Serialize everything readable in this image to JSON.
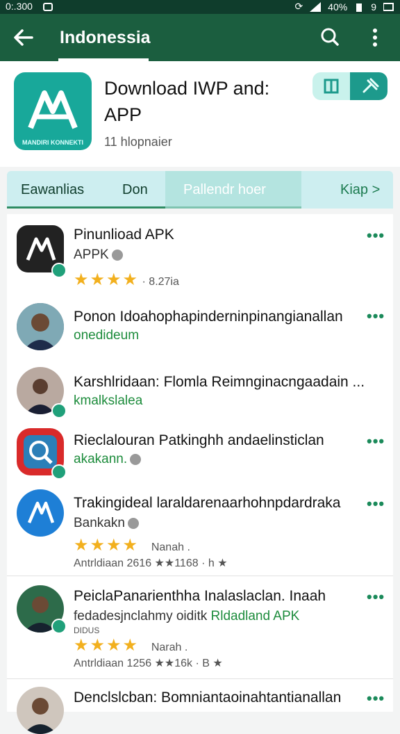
{
  "status": {
    "time": "0:.300",
    "battery": "40%",
    "signal_label": "9"
  },
  "appbar": {
    "title": "Indonessia",
    "back_icon": "arrow-left-icon",
    "search_icon": "search-icon",
    "more_icon": "more-vert-icon"
  },
  "header": {
    "app_title": "Download IWP and: APP",
    "subtitle": "11 hlopnaier",
    "icon_caption": "MANDIRI KONNEKTI"
  },
  "tabs": [
    {
      "label": "Eawanlias"
    },
    {
      "label": "Don"
    },
    {
      "label": "Pallendr hoer"
    },
    {
      "label": "Kiap >"
    }
  ],
  "list": [
    {
      "title": "Pinunlioad APK",
      "line2": "APPK",
      "rating_text": "· 8.27ia"
    },
    {
      "title": "Ponon Idoahophapinderninpinangianallan",
      "line2": "onedideum"
    },
    {
      "title": "Karshlridaan: Flomla Reimnginacngaadain ...",
      "line2": "kmalkslalea"
    },
    {
      "title": "Rieclalouran Patkinghh andaelinsticlan",
      "line2": "akakann."
    },
    {
      "title": "Trakingideal laraldarenaarhohnpdardraka",
      "line2": "Bankakn",
      "rating_label": "Nanah .",
      "meta": "Antrldiaan 2616 ★★1168 · h ★"
    },
    {
      "title": "PeiclaPanarienthha Inalaslaclan. Inaah",
      "line2a": "fedadesjnclahmy oiditk",
      "line2b": "Rldadland APK",
      "line3": "DIDUS",
      "rating_label": "Narah .",
      "meta": "Antrldiaan 1256 ★★16k · B ★"
    },
    {
      "title": "Denclslcban: Bomniantaoinahtantianallan"
    }
  ]
}
